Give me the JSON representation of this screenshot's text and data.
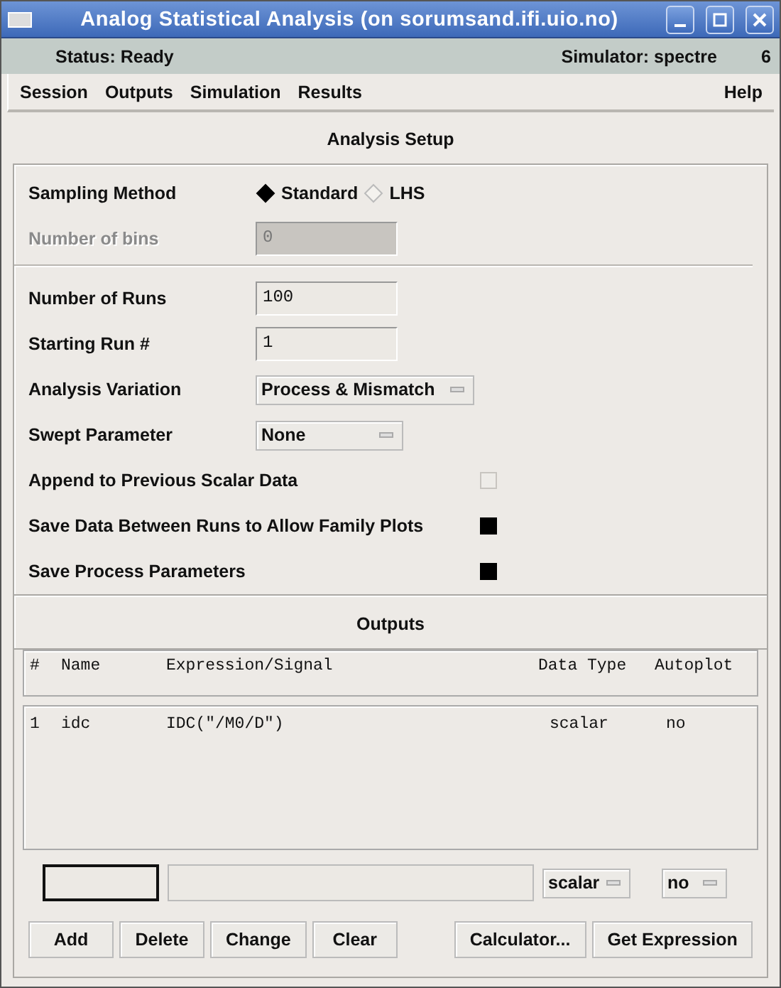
{
  "window": {
    "title": "Analog Statistical Analysis (on sorumsand.ifi.uio.no)"
  },
  "status_bar": {
    "status": "Status: Ready",
    "simulator": "Simulator: spectre",
    "number": "6"
  },
  "menu": [
    {
      "label": "Session"
    },
    {
      "label": "Outputs"
    },
    {
      "label": "Simulation"
    },
    {
      "label": "Results"
    },
    {
      "label": "Help"
    }
  ],
  "setup": {
    "heading": "Analysis Setup",
    "sampling_method": {
      "label": "Sampling Method",
      "options": [
        {
          "label": "Standard",
          "selected": true
        },
        {
          "label": "LHS",
          "selected": false
        }
      ]
    },
    "number_of_bins": {
      "label": "Number of bins",
      "value": "0",
      "disabled": true
    },
    "number_of_runs": {
      "label": "Number of Runs",
      "value": "100"
    },
    "starting_run": {
      "label": "Starting Run #",
      "value": "1"
    },
    "analysis_variation": {
      "label": "Analysis Variation",
      "value": "Process & Mismatch"
    },
    "swept_parameter": {
      "label": "Swept Parameter",
      "value": "None"
    },
    "checkboxes": [
      {
        "label": "Append to Previous Scalar Data",
        "checked": false
      },
      {
        "label": "Save Data Between Runs to Allow Family Plots",
        "checked": true
      },
      {
        "label": "Save Process Parameters",
        "checked": true
      }
    ]
  },
  "outputs": {
    "heading": "Outputs",
    "columns": [
      "#",
      "Name",
      "Expression/Signal",
      "Data Type",
      "Autoplot"
    ],
    "rows": [
      [
        "1",
        "idc",
        "IDC(\"/M0/D\")",
        "scalar",
        "no"
      ]
    ],
    "data_type": "scalar",
    "autoplot": "no",
    "edit_buttons": [
      {
        "label": "Add"
      },
      {
        "label": "Delete"
      },
      {
        "label": "Change"
      },
      {
        "label": "Clear"
      }
    ],
    "tool_buttons": [
      {
        "label": "Calculator..."
      },
      {
        "label": "Get Expression"
      }
    ]
  }
}
